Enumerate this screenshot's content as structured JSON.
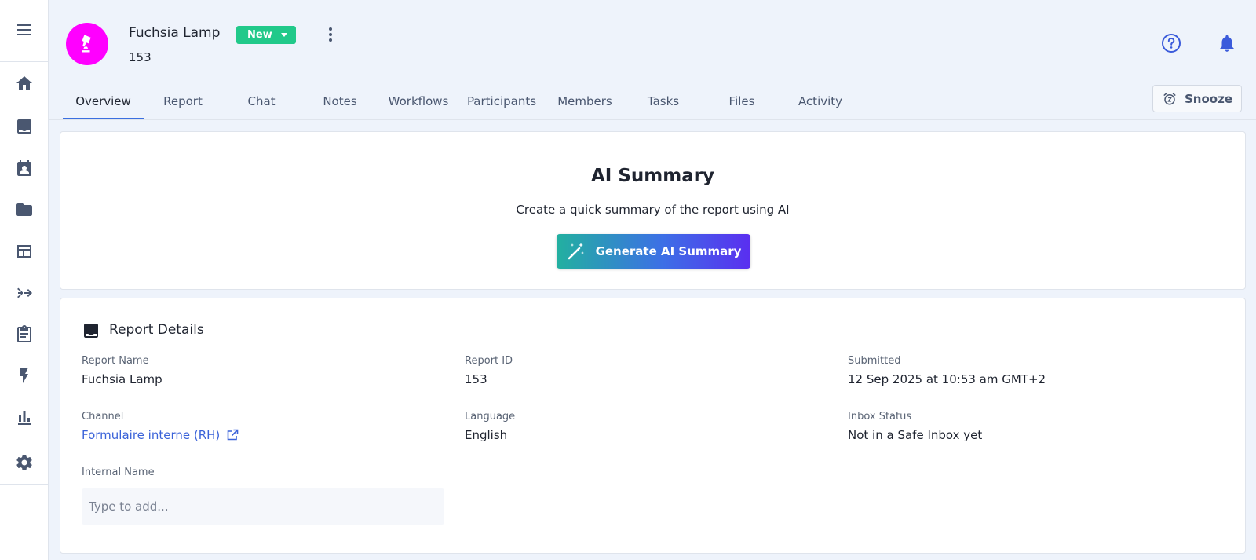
{
  "sidebar": {
    "items": [
      {
        "name": "menu",
        "icon": "menu-icon"
      },
      {
        "name": "home",
        "icon": "home-icon"
      },
      {
        "name": "inbox",
        "icon": "inbox-icon"
      },
      {
        "name": "calendar",
        "icon": "calendar-user-icon"
      },
      {
        "name": "folder",
        "icon": "folder-icon"
      },
      {
        "name": "dashboard",
        "icon": "dashboard-icon"
      },
      {
        "name": "merge",
        "icon": "merge-arrow-icon"
      },
      {
        "name": "clipboard",
        "icon": "clipboard-icon"
      },
      {
        "name": "automation",
        "icon": "lightning-icon"
      },
      {
        "name": "analytics",
        "icon": "bar-chart-icon"
      },
      {
        "name": "settings",
        "icon": "gear-icon"
      }
    ]
  },
  "header": {
    "title": "Fuchsia Lamp",
    "subtitle": "153",
    "avatar_color": "#ff00ff",
    "avatar_icon": "lamp-icon",
    "status_badge": "New",
    "status_color": "#21c98a"
  },
  "tabs": [
    {
      "label": "Overview",
      "active": true
    },
    {
      "label": "Report",
      "active": false
    },
    {
      "label": "Chat",
      "active": false
    },
    {
      "label": "Notes",
      "active": false
    },
    {
      "label": "Workflows",
      "active": false
    },
    {
      "label": "Participants",
      "active": false
    },
    {
      "label": "Members",
      "active": false
    },
    {
      "label": "Tasks",
      "active": false
    },
    {
      "label": "Files",
      "active": false
    },
    {
      "label": "Activity",
      "active": false
    }
  ],
  "snooze_label": "Snooze",
  "ai_summary": {
    "title": "AI Summary",
    "description": "Create a quick summary of the report using AI",
    "button_label": "Generate AI Summary"
  },
  "report_details": {
    "title": "Report Details",
    "fields": {
      "report_name": {
        "label": "Report Name",
        "value": "Fuchsia Lamp"
      },
      "report_id": {
        "label": "Report ID",
        "value": "153"
      },
      "submitted": {
        "label": "Submitted",
        "value": "12 Sep 2025 at 10:53 am GMT+2"
      },
      "channel": {
        "label": "Channel",
        "value": "Formulaire interne (RH)"
      },
      "language": {
        "label": "Language",
        "value": "English"
      },
      "inbox_status": {
        "label": "Inbox Status",
        "value": "Not in a Safe Inbox yet"
      },
      "internal_name": {
        "label": "Internal Name",
        "value": "",
        "placeholder": "Type to add..."
      }
    }
  },
  "colors": {
    "accent": "#3b6fe0",
    "link": "#3b63d9",
    "icon_blue": "#3b5bdb"
  }
}
